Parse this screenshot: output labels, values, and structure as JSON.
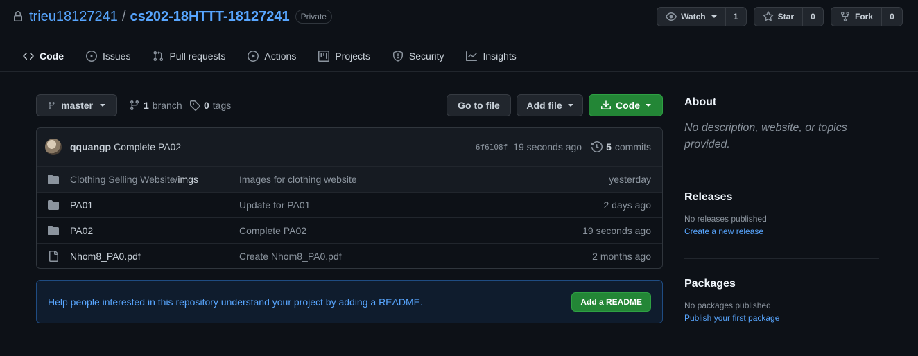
{
  "repo": {
    "owner": "trieu18127241",
    "separator": "/",
    "name": "cs202-18HTTT-18127241",
    "visibility": "Private"
  },
  "actions": {
    "watch": {
      "label": "Watch",
      "count": "1"
    },
    "star": {
      "label": "Star",
      "count": "0"
    },
    "fork": {
      "label": "Fork",
      "count": "0"
    }
  },
  "tabs": [
    {
      "label": "Code",
      "icon": "code-icon",
      "active": true
    },
    {
      "label": "Issues",
      "icon": "issue-icon"
    },
    {
      "label": "Pull requests",
      "icon": "pull-request-icon"
    },
    {
      "label": "Actions",
      "icon": "play-icon"
    },
    {
      "label": "Projects",
      "icon": "project-icon"
    },
    {
      "label": "Security",
      "icon": "shield-icon"
    },
    {
      "label": "Insights",
      "icon": "graph-icon"
    }
  ],
  "nav": {
    "branch": "master",
    "branches_count": "1",
    "branches_label": "branch",
    "tags_count": "0",
    "tags_label": "tags",
    "go_to_file": "Go to file",
    "add_file": "Add file",
    "code": "Code"
  },
  "commit": {
    "author": "qquangp",
    "message": "Complete PA02",
    "sha": "6f6108f",
    "time": "19 seconds ago",
    "commits_count": "5",
    "commits_label": "commits"
  },
  "files": [
    {
      "type": "folder",
      "name_prefix": "Clothing Selling Website/",
      "name": "imgs",
      "message": "Images for clothing website",
      "age": "yesterday"
    },
    {
      "type": "folder",
      "name_prefix": "",
      "name": "PA01",
      "message": "Update for PA01",
      "age": "2 days ago"
    },
    {
      "type": "folder",
      "name_prefix": "",
      "name": "PA02",
      "message": "Complete PA02",
      "age": "19 seconds ago"
    },
    {
      "type": "file",
      "name_prefix": "",
      "name": "Nhom8_PA0.pdf",
      "message": "Create Nhom8_PA0.pdf",
      "age": "2 months ago"
    }
  ],
  "readme": {
    "text": "Help people interested in this repository understand your project by adding a README.",
    "button": "Add a README"
  },
  "sidebar": {
    "about_title": "About",
    "about_desc": "No description, website, or topics provided.",
    "releases_title": "Releases",
    "releases_none": "No releases published",
    "releases_link": "Create a new release",
    "packages_title": "Packages",
    "packages_none": "No packages published",
    "packages_link": "Publish your first package"
  },
  "colors": {
    "background": "#0d1117",
    "link": "#58a6ff",
    "green": "#238636",
    "tab_underline": "#f78166"
  }
}
